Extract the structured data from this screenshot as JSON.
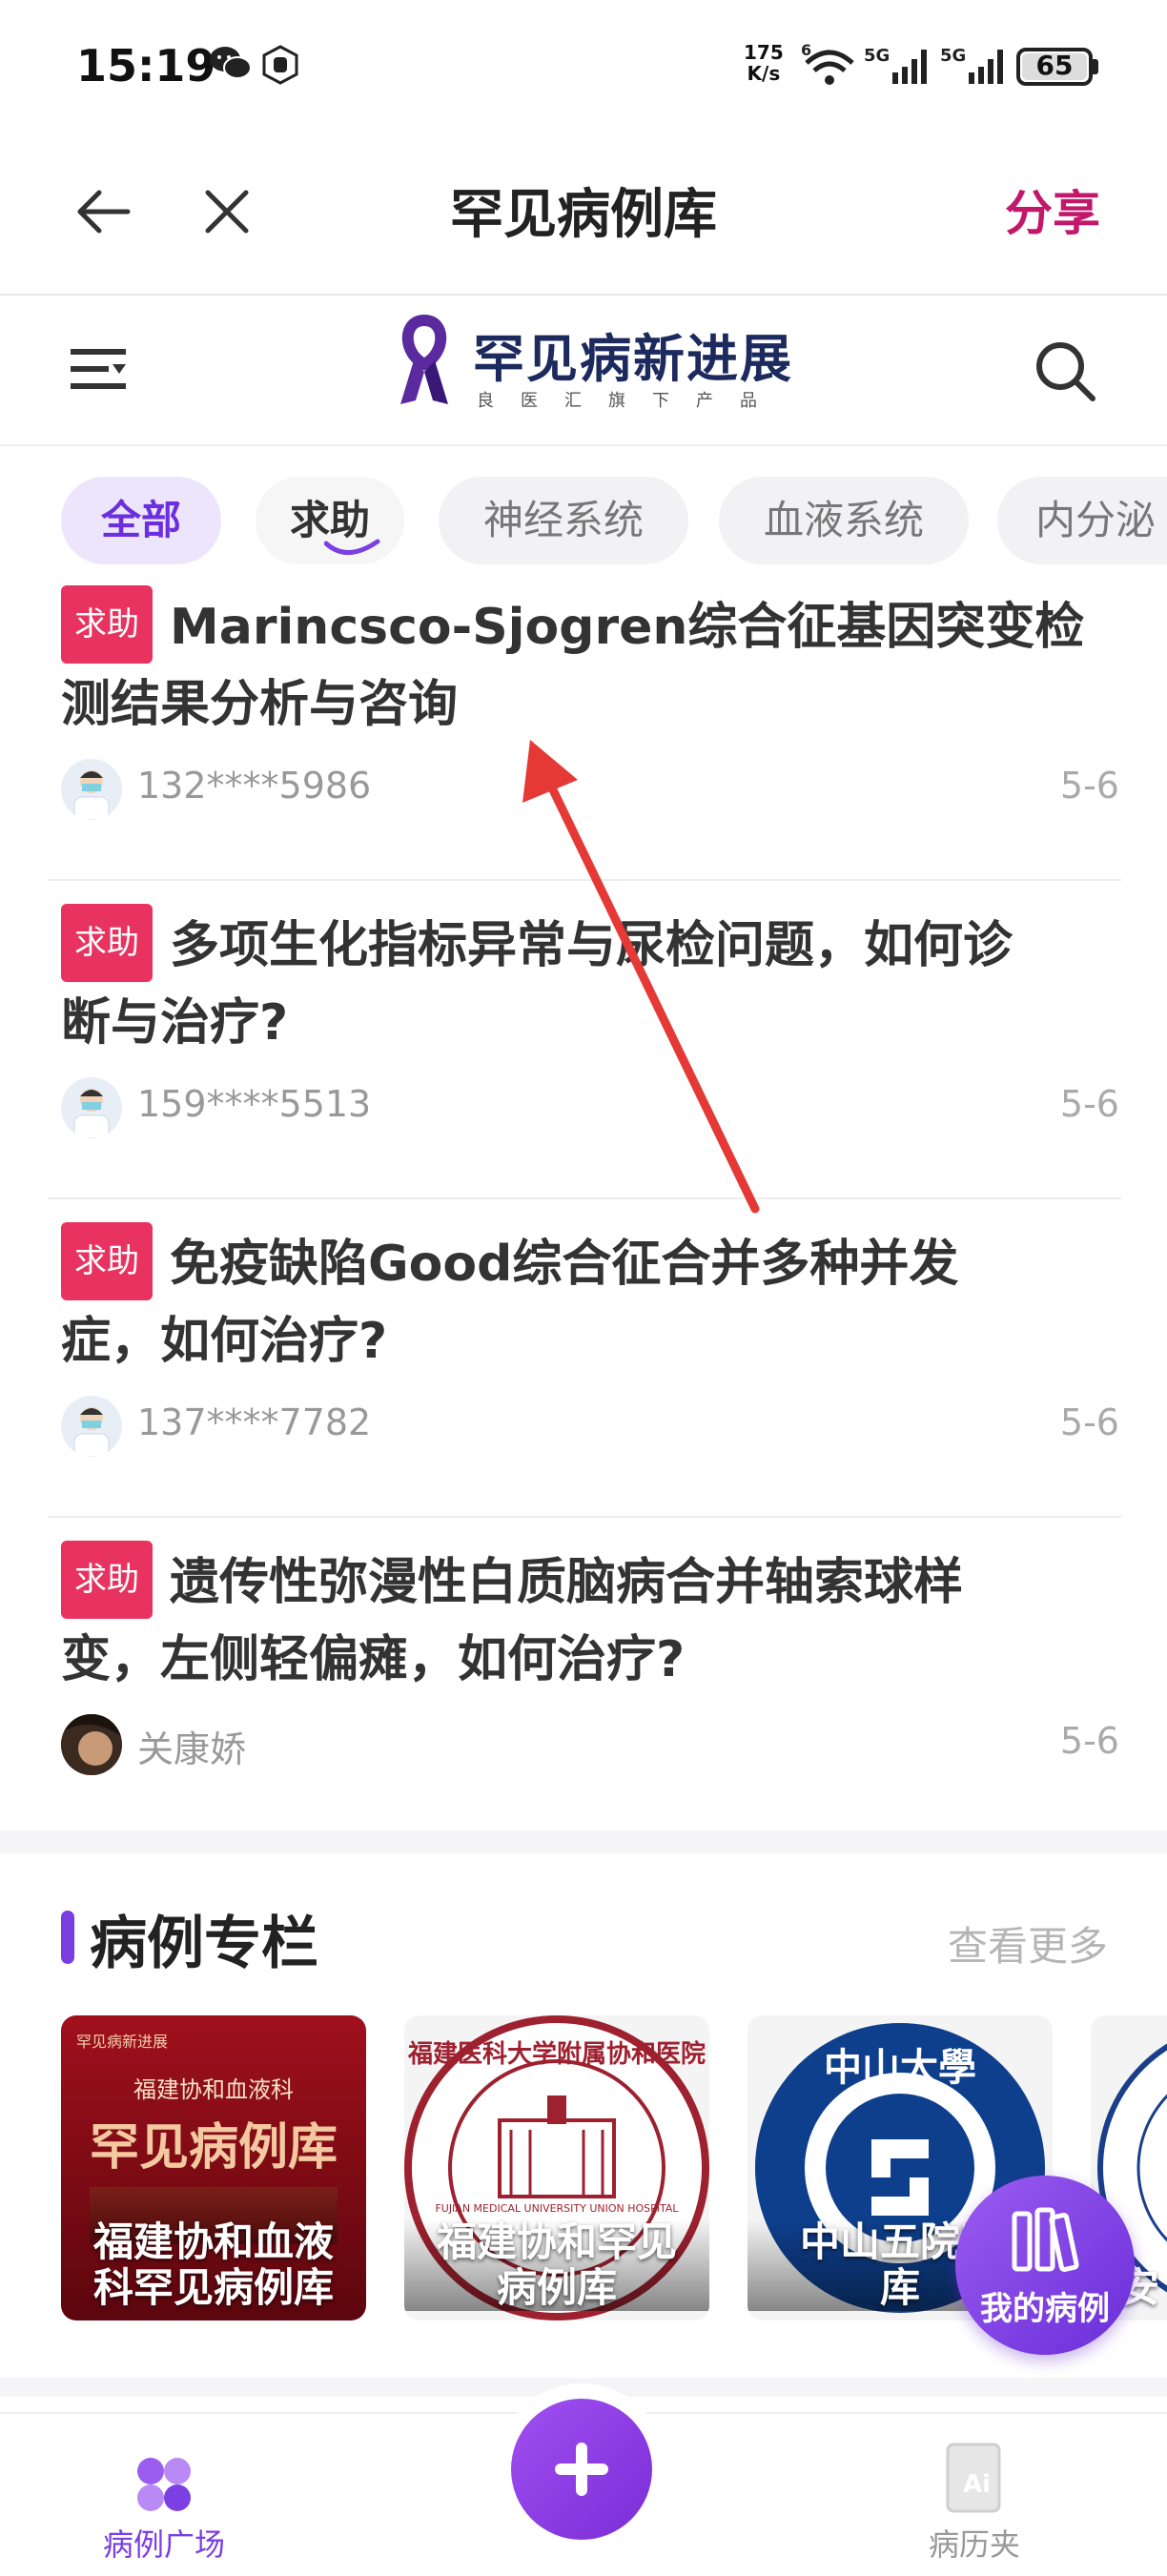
{
  "status_bar": {
    "time": "15:19",
    "speed_top": "175",
    "speed_bottom": "K/s",
    "net1": "5G",
    "net2": "5G",
    "wifi_badge": "6",
    "battery": "65"
  },
  "nav": {
    "title": "罕见病例库",
    "share_label": "分享",
    "share_color": "#c2186b"
  },
  "brand": {
    "title": "罕见病新进展",
    "subtitle": "良医汇旗下产品",
    "accent": "#5b2a9e"
  },
  "tabs": [
    {
      "label": "全部",
      "active": true
    },
    {
      "label": "求助"
    },
    {
      "label": "神经系统"
    },
    {
      "label": "血液系统"
    },
    {
      "label": "内分泌"
    }
  ],
  "cases": [
    {
      "badge": "求助",
      "title_line1": "Marincsco-Sjogren综合征基因突变检",
      "title_line2": "测结果分析与咨询",
      "user": "132****5986",
      "date": "5-6"
    },
    {
      "badge": "求助",
      "title_line1": "多项生化指标异常与尿检问题，如何诊",
      "title_line2": "断与治疗?",
      "user": "159****5513",
      "date": "5-6"
    },
    {
      "badge": "求助",
      "title_line1": "免疫缺陷Good综合征合并多种并发",
      "title_line2": "症，如何治疗?",
      "user": "137****7782",
      "date": "5-6"
    },
    {
      "badge": "求助",
      "title_line1": "遗传性弥漫性白质脑病合并轴索球样",
      "title_line2": "变，左侧轻偏瘫，如何治疗?",
      "user": "关康娇",
      "date": "5-6"
    }
  ],
  "section": {
    "title": "病例专栏",
    "more": "查看更多",
    "cards": [
      {
        "label_line1": "福建协和血液",
        "label_line2": "科罕见病例库",
        "banner_top": "福建协和血液科",
        "banner_big": "罕见病例库",
        "brand_small": "罕见病新进展"
      },
      {
        "label_line1": "福建协和罕见",
        "label_line2": "病例库",
        "seal_text": "福建医科大学附属协和医院",
        "seal_en": "FUJIAN MEDICAL UNIVERSITY UNION HOSPITAL"
      },
      {
        "label_line1": "中山五院罕",
        "label_line2": "库",
        "seal_text": "中山大學"
      },
      {
        "label_line1": "安",
        "label_line2": ""
      }
    ]
  },
  "fab": {
    "label": "我的病例"
  },
  "tabbar": {
    "left_label": "病例广场",
    "right_label": "病历夹",
    "right_icon_text": "Ai"
  }
}
